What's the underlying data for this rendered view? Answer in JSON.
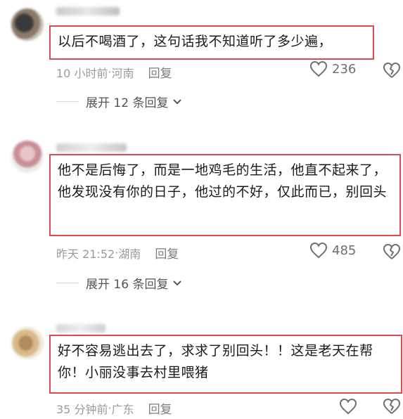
{
  "comments": [
    {
      "text": "以后不喝酒了，这句话我不知道听了多少遍，",
      "time": "10 小时前",
      "location": "河南",
      "reply_label": "回复",
      "likes": "236",
      "expand_label": "展开 12 条回复"
    },
    {
      "text": "他不是后悔了，而是一地鸡毛的生活，他直不起来了，他发现没有你的日子，他过的不好，仅此而已，别回头",
      "time": "昨天 21:52",
      "location": "湖南",
      "reply_label": "回复",
      "likes": "485",
      "expand_label": "展开 16 条回复"
    },
    {
      "text": "好不容易逃出去了，求求了别回头！！这是老天在帮你！小丽没事去村里喂猪",
      "time": "35 分钟前",
      "location": "广东",
      "reply_label": "回复",
      "likes": "",
      "expand_label": ""
    }
  ],
  "separator": " · ",
  "icons": {
    "like": "heart-outline-icon",
    "dislike": "broken-heart-icon",
    "expand": "chevron-down-icon"
  },
  "colors": {
    "highlight_border": "#e04a4a",
    "meta_text": "#9a9a9a"
  }
}
